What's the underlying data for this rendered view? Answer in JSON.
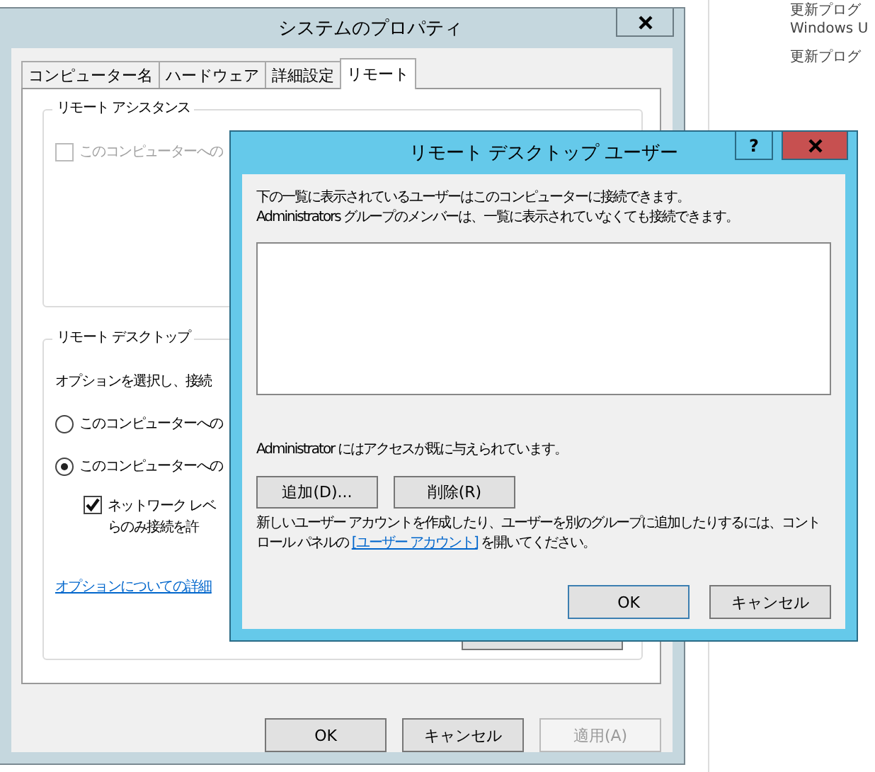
{
  "background_window": {
    "lines": [
      "更新プログ",
      "Windows U",
      "更新プログ"
    ]
  },
  "system_properties": {
    "title": "システムのプロパティ",
    "tabs": [
      {
        "label": "コンピューター名",
        "selected": false
      },
      {
        "label": "ハードウェア",
        "selected": false
      },
      {
        "label": "詳細設定",
        "selected": false
      },
      {
        "label": "リモート",
        "selected": true
      }
    ],
    "remote_assistance": {
      "legend": "リモート アシスタンス",
      "checkbox": {
        "label": "このコンピューターへの",
        "checked": false,
        "disabled": true
      }
    },
    "remote_desktop": {
      "legend": "リモート デスクトップ",
      "instruction": "オプションを選択し、接続",
      "options": [
        {
          "label": "このコンピューターへの",
          "selected": false
        },
        {
          "label": "このコンピューターへの",
          "selected": true
        }
      ],
      "nla": {
        "label_lines": [
          "ネットワーク レベ",
          "らのみ接続を許"
        ],
        "checked": true
      },
      "link": "オプションについての詳細"
    },
    "buttons": [
      {
        "label": "OK",
        "disabled": false
      },
      {
        "label": "キャンセル",
        "disabled": false
      },
      {
        "label": "適用(A)",
        "disabled": true
      }
    ]
  },
  "remote_desktop_users": {
    "title": "リモート デスクトップ ユーザー",
    "help": "?",
    "description_lines": [
      "下の一覧に表示されているユーザーはこのコンピューターに接続できます。",
      "Administrators グループのメンバーは、一覧に表示されていなくても接続できます。"
    ],
    "status": "Administrator にはアクセスが既に与えられています。",
    "actions": [
      "追加(D)...",
      "削除(R)"
    ],
    "note": {
      "before": "新しいユーザー アカウントを作成したり、ユーザーを別のグループに追加したりするには、コントロール パネルの ",
      "link": "[ユーザー アカウント]",
      "after": " を開いてください。"
    },
    "buttons": [
      {
        "label": "OK",
        "default": true
      },
      {
        "label": "キャンセル",
        "default": false
      }
    ]
  }
}
